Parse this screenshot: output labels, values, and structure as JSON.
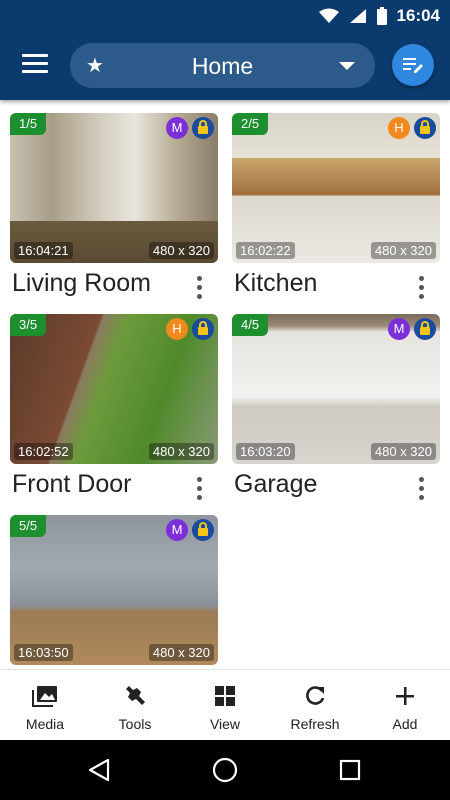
{
  "status_bar": {
    "time": "16:04"
  },
  "app_bar": {
    "location_label": "Home"
  },
  "cameras": [
    {
      "index": "1/5",
      "mode": "M",
      "mode_color": "#7b2fd8",
      "timestamp": "16:04:21",
      "resolution": "480 x 320",
      "name": "Living Room"
    },
    {
      "index": "2/5",
      "mode": "H",
      "mode_color": "#f08a1c",
      "timestamp": "16:02:22",
      "resolution": "480 x 320",
      "name": "Kitchen"
    },
    {
      "index": "3/5",
      "mode": "H",
      "mode_color": "#f08a1c",
      "timestamp": "16:02:52",
      "resolution": "480 x 320",
      "name": "Front Door"
    },
    {
      "index": "4/5",
      "mode": "M",
      "mode_color": "#7b2fd8",
      "timestamp": "16:03:20",
      "resolution": "480 x 320",
      "name": "Garage"
    },
    {
      "index": "5/5",
      "mode": "M",
      "mode_color": "#7b2fd8",
      "timestamp": "16:03:50",
      "resolution": "480 x 320",
      "name": ""
    }
  ],
  "bottom_nav": {
    "media": "Media",
    "tools": "Tools",
    "view": "View",
    "refresh": "Refresh",
    "add": "Add"
  },
  "colors": {
    "app_bar": "#0b3b6e",
    "index_badge": "#1e8f2e",
    "lock_badge": "#1a4b9e",
    "edit_button": "#2f88e0"
  }
}
